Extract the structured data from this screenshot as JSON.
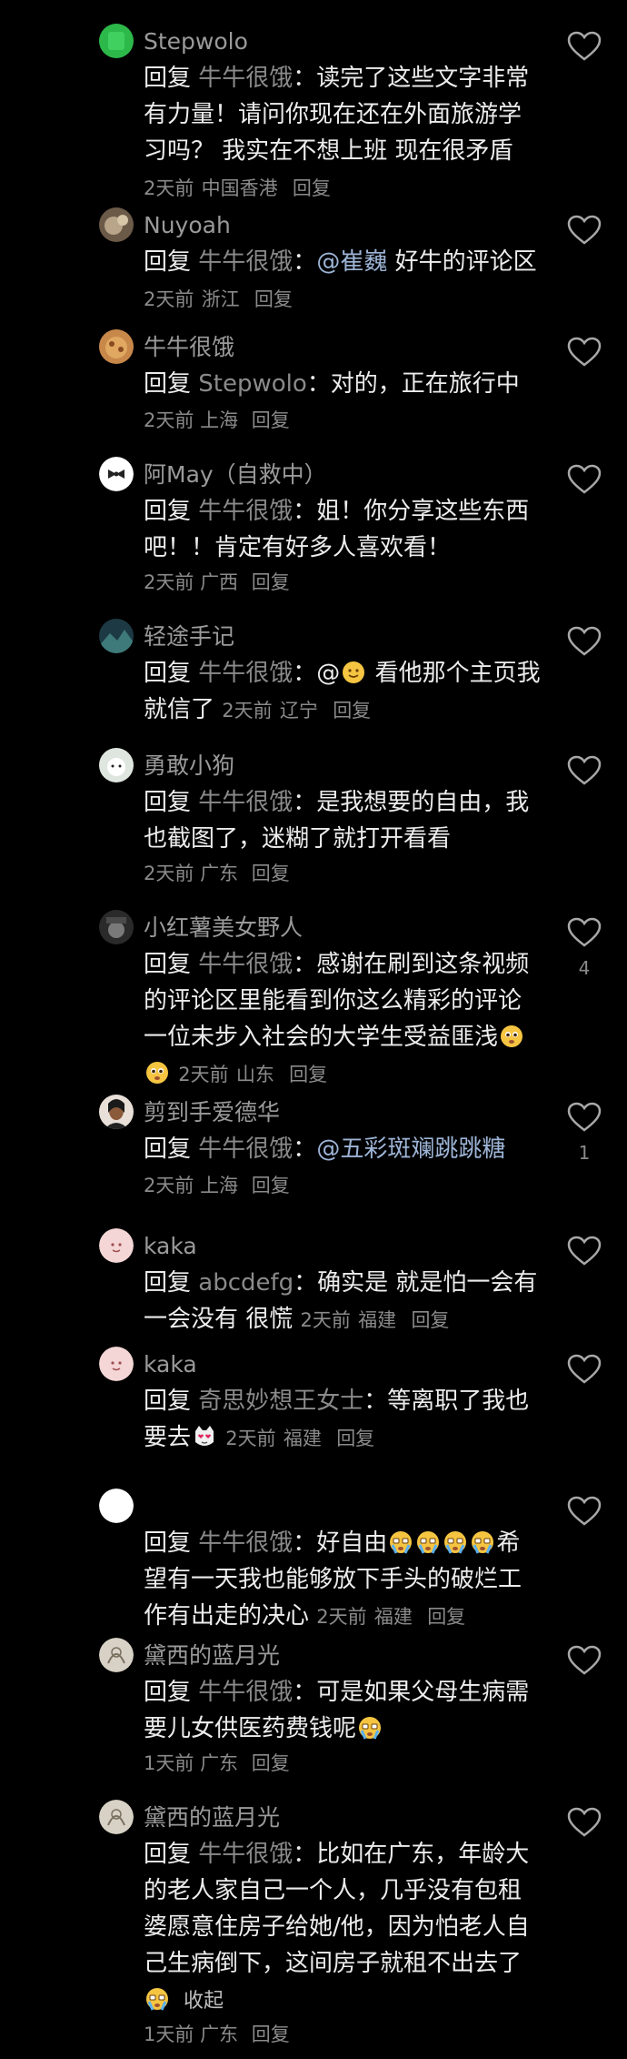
{
  "colors": {
    "background": "#000000",
    "username": "#9a9a9a",
    "body": "#ececec",
    "meta": "#8a8a8a",
    "mention": "#9db4d6"
  },
  "reply_word": "回复",
  "reply_button": "回复",
  "comments": [
    {
      "username": "Stepwolo",
      "target": "牛牛很饿",
      "text": "：读完了这些文字非常有力量！请问你现在还在外面旅游学习吗？ 我实在不想上班 现在很矛盾",
      "time": "2天前",
      "location": "中国香港",
      "avatar_icon": "green-square-avatar"
    },
    {
      "username": "Nuyoah",
      "target": "牛牛很饿",
      "text_before": "：",
      "mention": "@崔巍",
      "text_after": " 好牛的评论区",
      "time": "2天前",
      "location": "浙江",
      "avatar_icon": "cat-avatar"
    },
    {
      "username": "牛牛很饿",
      "target": "Stepwolo",
      "text": "：对的，正在旅行中",
      "time": "2天前",
      "location": "上海",
      "avatar_icon": "food-avatar"
    },
    {
      "username": "阿May（自救中）",
      "target": "牛牛很饿",
      "text": "：姐！你分享这些东西吧！！肯定有好多人喜欢看！",
      "time": "2天前",
      "location": "广西",
      "avatar_icon": "bow-avatar"
    },
    {
      "username": "轻途手记",
      "target": "牛牛很饿",
      "text_before": "：@",
      "text_after": " 看他那个主页我就信了",
      "time": "2天前",
      "location": "辽宁",
      "avatar_icon": "landscape-avatar",
      "emoji": "sun-emoji"
    },
    {
      "username": "勇敢小狗",
      "target": "牛牛很饿",
      "text": "：是我想要的自由，我也截图了，迷糊了就打开看看",
      "time": "2天前",
      "location": "广东",
      "avatar_icon": "puppy-avatar"
    },
    {
      "username": "小红薯美女野人",
      "target": "牛牛很饿",
      "text": "：感谢在刷到这条视频的评论区里能看到你这么精彩的评论 一位未步入社会的大学生受益匪浅",
      "time": "2天前",
      "location": "山东",
      "likes": "4",
      "avatar_icon": "hat-avatar",
      "emoji": "pleading-emoji"
    },
    {
      "username": "剪到手爱德华",
      "target": "牛牛很饿",
      "text_before": "：",
      "mention": "@五彩斑斓跳跳糖",
      "time": "2天前",
      "location": "上海",
      "likes": "1",
      "avatar_icon": "portrait-avatar"
    },
    {
      "username": "kaka",
      "target": "abcdefg",
      "text": "：确实是 就是怕一会有一会没有 很慌",
      "time": "2天前",
      "location": "福建",
      "avatar_icon": "pink-avatar"
    },
    {
      "username": "kaka",
      "target": "奇思妙想王女士",
      "text_before": "：等离职了我也要去",
      "time": "2天前",
      "location": "福建",
      "avatar_icon": "pink-avatar",
      "emoji": "heart-eyes-cat-emoji"
    },
    {
      "username": "",
      "target": "牛牛很饿",
      "text_before": "：好自由",
      "text_after": "希望有一天我也能够放下手头的破烂工作有出走的决心",
      "time": "2天前",
      "location": "福建",
      "avatar_icon": "white-circle-avatar",
      "emoji": "crying-emoji"
    },
    {
      "username": "黛西的蓝月光",
      "target": "牛牛很饿",
      "text_before": "：可是如果父母生病需要儿女供医药费钱呢",
      "time": "1天前",
      "location": "广东",
      "avatar_icon": "sketch-avatar",
      "emoji": "crying-emoji"
    },
    {
      "username": "黛西的蓝月光",
      "target": "牛牛很饿",
      "text_before": "：比如在广东，年龄大的老人家自己一个人，几乎没有包租婆愿意住房子给她/他，因为怕老人自己生病倒下，这间房子就租不出去了",
      "collapse": "收起",
      "time": "1天前",
      "location": "广东",
      "avatar_icon": "sketch-avatar",
      "emoji": "crying-emoji"
    }
  ]
}
